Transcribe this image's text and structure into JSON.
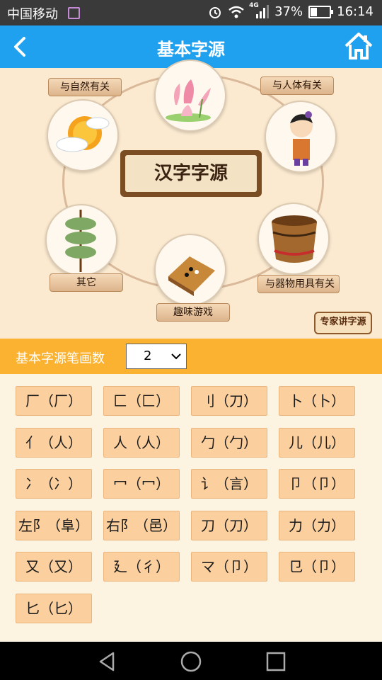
{
  "status": {
    "carrier": "中国移动",
    "network": "4G",
    "battery": "37%",
    "battery_level": 0.37,
    "time": "16:14"
  },
  "appbar": {
    "title": "基本字源"
  },
  "hero": {
    "center_title": "汉字字源",
    "categories": [
      {
        "label": "与自然有关"
      },
      {
        "label": "与人体有关"
      },
      {
        "label": "其它"
      },
      {
        "label": "与器物用具有关"
      },
      {
        "label": "趣味游戏"
      }
    ],
    "expert_button": "专家讲字源"
  },
  "filter": {
    "label": "基本字源笔画数",
    "selected": "2"
  },
  "radicals": [
    "厂（厂）",
    "匚（匚）",
    "刂（刀）",
    "卜（卜）",
    "亻（人）",
    "人（人）",
    "勹（勹）",
    "儿（儿）",
    "冫（冫）",
    "冖（冖）",
    "讠（言）",
    "卩（卩）",
    "左阝（阜）",
    "右阝（邑）",
    "刀（刀）",
    "力（力）",
    "又（又）",
    "廴（彳）",
    "マ（卩）",
    "㔾（卩）",
    "匕（匕）"
  ],
  "colors": {
    "appbar": "#1fa1f0",
    "filter_bar": "#fbb230",
    "cell": "#fbcf9e",
    "background": "#fdf3e1"
  }
}
